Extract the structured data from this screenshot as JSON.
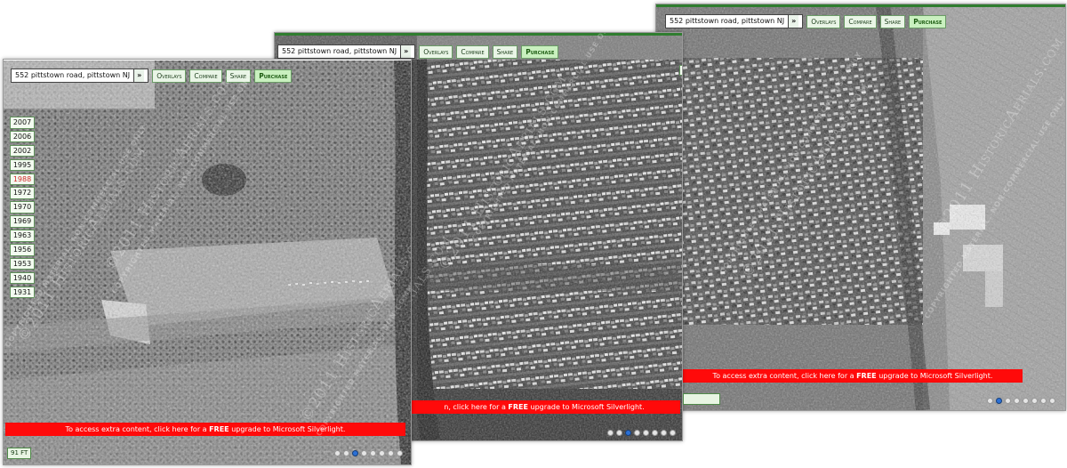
{
  "toolbar": {
    "address": "552 pittstown road, pittstown NJ",
    "go_label": "»",
    "overlays_label": "Overlays",
    "compare_label": "Compare",
    "share_label": "Share",
    "purchase_label": "Purchase"
  },
  "years": [
    "2007",
    "2006",
    "2002",
    "1995",
    "1988",
    "1972",
    "1970",
    "1969",
    "1963",
    "1956",
    "1953",
    "1940",
    "1931"
  ],
  "active_year": "1988",
  "banner": {
    "before": "To access extra content, click here for a ",
    "bold": "FREE",
    "after": " upgrade to Microsoft Silverlight."
  },
  "banner_mid": {
    "before": "n, click here for a ",
    "bold": "FREE",
    "after": " upgrade to Microsoft Silverlight."
  },
  "scale_label": "91 FT",
  "watermark": {
    "main": "©2011 HistoricAerials.com",
    "sub": "COPYRIGHTED MATERIAL, NON-COMMERCIAL USE ONLY"
  },
  "colors": {
    "accent_green": "#2f7d2f",
    "banner_red": "#ff0a0a",
    "active_year": "#d22a2a",
    "active_dot": "#2b70d6"
  }
}
